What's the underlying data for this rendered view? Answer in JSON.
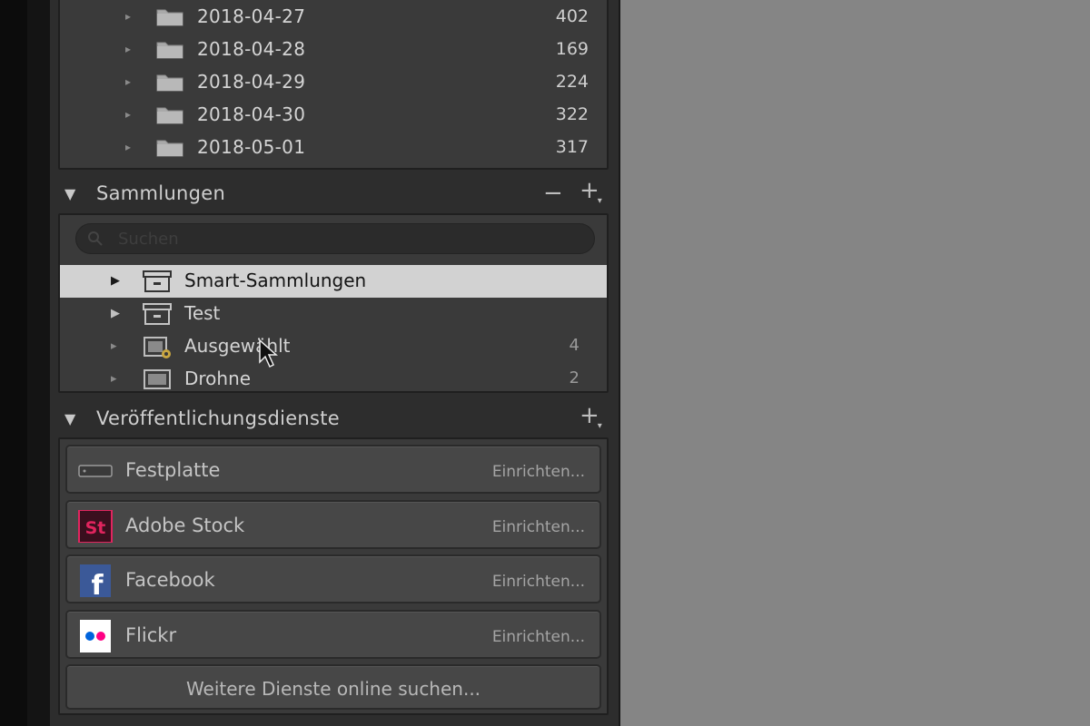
{
  "folders": {
    "items": [
      {
        "name": "2018-04-27",
        "count": "402"
      },
      {
        "name": "2018-04-28",
        "count": "169"
      },
      {
        "name": "2018-04-29",
        "count": "224"
      },
      {
        "name": "2018-04-30",
        "count": "322"
      },
      {
        "name": "2018-05-01",
        "count": "317"
      }
    ]
  },
  "collections": {
    "title": "Sammlungen",
    "minus": "−",
    "plus": "+",
    "search_placeholder": "Suchen",
    "items": [
      {
        "name": "Smart-Sammlungen",
        "count": "",
        "selected": true,
        "icon": "collection-set-icon"
      },
      {
        "name": "Test",
        "count": "",
        "selected": false,
        "icon": "collection-set-icon"
      },
      {
        "name": "Ausgewählt",
        "count": "4",
        "selected": false,
        "icon": "smart-collection-icon"
      },
      {
        "name": "Drohne",
        "count": "2",
        "selected": false,
        "icon": "collection-icon"
      }
    ]
  },
  "publish": {
    "title": "Veröffentlichungsdienste",
    "plus": "+",
    "services": [
      {
        "name": "Festplatte",
        "action": "Einrichten...",
        "icon": "hard-drive-icon"
      },
      {
        "name": "Adobe Stock",
        "action": "Einrichten...",
        "icon": "adobe-stock-icon",
        "logo_text": "St",
        "color": "#e0245e"
      },
      {
        "name": "Facebook",
        "action": "Einrichten...",
        "icon": "facebook-icon",
        "logo_text": "f",
        "color": "#3b5998"
      },
      {
        "name": "Flickr",
        "action": "Einrichten...",
        "icon": "flickr-icon",
        "colors": [
          "#0063dc",
          "#ff0084"
        ]
      }
    ],
    "more_label": "Weitere Dienste online suchen..."
  },
  "colors": {
    "panel_bg": "#2d2d2d",
    "content_bg": "#858585",
    "selection": "#d2d2d2"
  }
}
